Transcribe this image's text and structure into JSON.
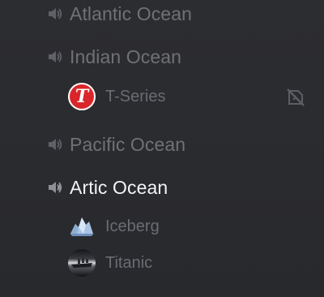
{
  "channels": [
    {
      "name": "Atlantic Ocean",
      "active": false
    },
    {
      "name": "Indian Ocean",
      "active": false
    },
    {
      "name": "Pacific Ocean",
      "active": false
    },
    {
      "name": "Artic Ocean",
      "active": true
    }
  ],
  "users": [
    {
      "name": "T-Series",
      "avatar_letter": "T",
      "channel": "Indian Ocean"
    },
    {
      "name": "Iceberg",
      "channel": "Artic Ocean"
    },
    {
      "name": "Titanic",
      "channel": "Artic Ocean"
    }
  ],
  "colors": {
    "background": "#2b2c30",
    "channel_text": "#6f7175",
    "active_channel_text": "#f2f3f5",
    "user_text": "#6a6c71",
    "tseries_red": "#d9262b"
  },
  "icons": {
    "channel": "volume-icon",
    "user_status": "screen-share-icon"
  }
}
